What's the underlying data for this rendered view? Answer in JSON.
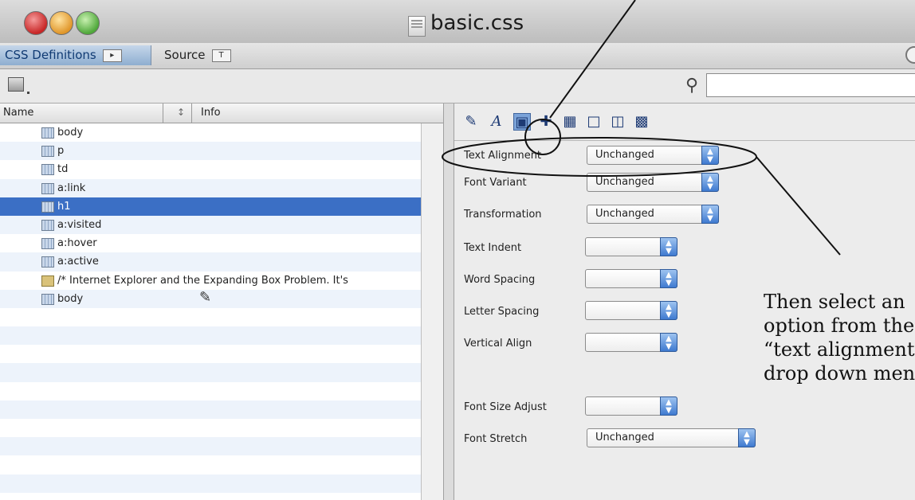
{
  "window": {
    "title": "basic.css"
  },
  "tabs": [
    {
      "label": "CSS Definitions"
    },
    {
      "label": "Source"
    }
  ],
  "list": {
    "columns": [
      "Name",
      "Info"
    ],
    "rows": [
      {
        "label": "body"
      },
      {
        "label": "p"
      },
      {
        "label": "td"
      },
      {
        "label": "a:link"
      },
      {
        "label": "h1",
        "selected": true
      },
      {
        "label": "a:visited"
      },
      {
        "label": "a:hover"
      },
      {
        "label": "a:active"
      },
      {
        "label": "/* Internet Explorer and the Expanding Box Problem. It's"
      },
      {
        "label": "body"
      }
    ]
  },
  "properties": {
    "rows": [
      {
        "label": "Text Alignment",
        "value": "Unchanged"
      },
      {
        "label": "Font Variant",
        "value": "Unchanged"
      },
      {
        "label": "Transformation",
        "value": "Unchanged"
      },
      {
        "label": "Text Indent",
        "value": ""
      },
      {
        "label": "Word Spacing",
        "value": ""
      },
      {
        "label": "Letter Spacing",
        "value": ""
      },
      {
        "label": "Vertical Align",
        "value": ""
      },
      {
        "label": "Font Size Adjust",
        "value": ""
      },
      {
        "label": "Font Stretch",
        "value": "Unchanged"
      }
    ]
  },
  "annotation": {
    "text": "Then select an\noption from the\n“text alignment”\ndrop down menu"
  },
  "colors": {
    "selection": "#3b6fc5",
    "accent_button": "#7ba3d8"
  }
}
